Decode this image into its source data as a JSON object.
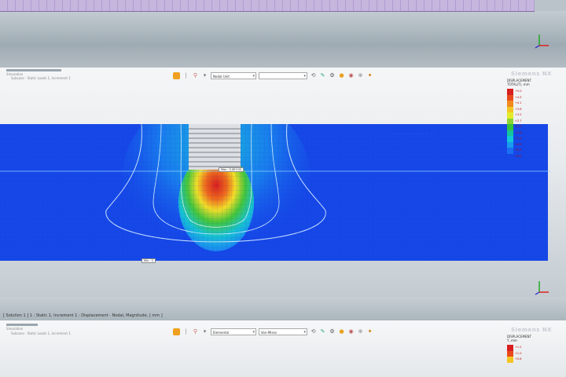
{
  "app": {
    "brand": "Siemens NX"
  },
  "main": {
    "panel_label_1": "Simulation",
    "panel_label_2": "Subcase - Static Loads 1, Increment 1",
    "result_select": "Nodal Unit",
    "component_select": "",
    "legend_title": "DISPLACEMENT",
    "legend_sub": "TOTAL(T), mm",
    "legend_values": [
      "+5.0",
      "+4.5",
      "+4.1",
      "+3.6",
      "+3.2",
      "+2.7",
      "+2.3",
      "+1.8",
      "+1.4",
      "+0.9",
      "+0.5",
      "+0.0"
    ],
    "marker_top": "Max : 5.0E+00",
    "marker_bottom": "Min : 0"
  },
  "status_bar": {
    "text": "[ Solution 1 ] 1 : Static 1, Increment 1 : Displacement - Nodal, Magnitude, [ mm ]"
  },
  "bottom": {
    "panel_label_1": "Simulation",
    "panel_label_2": "Subcase - Static Loads 1, Increment 1",
    "result_select": "Elemental",
    "component_select": "Von-Mises",
    "legend_title": "DISPLACEMENT",
    "legend_sub": "Y, mm",
    "legend_values": [
      "+1.2",
      "+1.0",
      "+0.8"
    ]
  },
  "colors": {
    "accent_blue": "#1648e8",
    "contour_red": "#e0301e",
    "contour_yellow": "#f2e22a",
    "contour_green": "#34c23b",
    "contour_cyan": "#12c6d8"
  }
}
